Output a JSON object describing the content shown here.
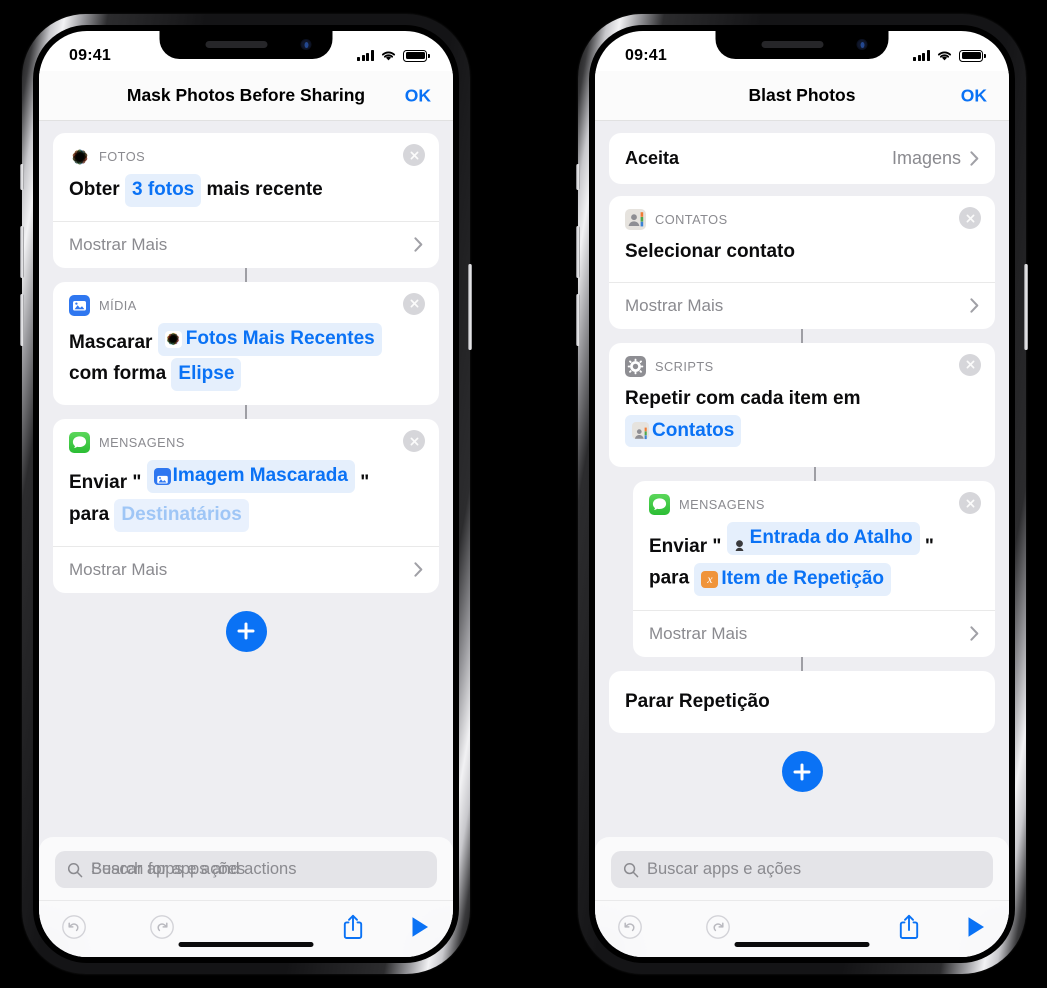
{
  "background_color": "#000000",
  "accent_color": "#0a72f5",
  "phones": [
    {
      "id": "left",
      "status": {
        "time": "09:41",
        "signal_icon": "cellular-bars-icon",
        "wifi_icon": "wifi-icon",
        "battery_icon": "battery-full-icon"
      },
      "nav": {
        "title": "Mask Photos Before Sharing",
        "action_label": "OK"
      },
      "cards": [
        {
          "type": "action",
          "app": "FOTOS",
          "app_icon": "photos-app-icon",
          "close_icon": "close-circle-icon",
          "line": {
            "pre": "Obter",
            "token": "3 fotos",
            "token_style": "blue",
            "post": "mais recente"
          },
          "show_more": "Mostrar Mais",
          "chevron_icon": "chevron-right-icon"
        },
        {
          "type": "action",
          "app": "MÍDIA",
          "app_icon": "media-app-icon",
          "close_icon": "close-circle-icon",
          "line1": {
            "pre": "Mascarar",
            "token": "Fotos Mais Recentes",
            "token_icon": "photos-app-icon",
            "token_style": "blue"
          },
          "line2": {
            "pre": "com forma",
            "token": "Elipse",
            "token_style": "blue"
          }
        },
        {
          "type": "action",
          "app": "MENSAGENS",
          "app_icon": "messages-app-icon",
          "close_icon": "close-circle-icon",
          "line1": {
            "pre": "Enviar \"",
            "token": "Imagem Mascarada",
            "token_icon": "media-app-icon",
            "token_style": "blue",
            "post": "\""
          },
          "line2": {
            "pre": "para",
            "token": "Destinatários",
            "token_style": "faded"
          },
          "show_more": "Mostrar Mais",
          "chevron_icon": "chevron-right-icon"
        }
      ],
      "add_button_icon": "plus-circle-icon",
      "search": {
        "icon": "search-icon",
        "placeholder": "Search for apps and actions",
        "placeholder_overlay": "Buscar apps e ações"
      },
      "toolbar": [
        {
          "name": "undo-icon",
          "enabled": false
        },
        {
          "name": "redo-icon",
          "enabled": false
        },
        {
          "name": "share-icon",
          "enabled": true
        },
        {
          "name": "play-icon",
          "enabled": true
        }
      ]
    },
    {
      "id": "right",
      "status": {
        "time": "09:41",
        "signal_icon": "cellular-bars-icon",
        "wifi_icon": "wifi-icon",
        "battery_icon": "battery-full-icon"
      },
      "nav": {
        "title": "Blast Photos",
        "action_label": "OK"
      },
      "accepts_row": {
        "label": "Aceita",
        "value": "Imagens",
        "chevron_icon": "chevron-right-icon"
      },
      "cards": [
        {
          "type": "action",
          "app": "CONTATOS",
          "app_icon": "contacts-app-icon",
          "close_icon": "close-circle-icon",
          "line": {
            "pre": "Selecionar contato"
          },
          "show_more": "Mostrar Mais",
          "chevron_icon": "chevron-right-icon"
        },
        {
          "type": "action",
          "app": "SCRIPTS",
          "app_icon": "scripts-app-icon",
          "close_icon": "close-circle-icon",
          "line1": {
            "pre": "Repetir com cada item em"
          },
          "line2": {
            "token": "Contatos",
            "token_icon": "contacts-app-icon",
            "token_style": "blue"
          }
        },
        {
          "type": "action",
          "indent": true,
          "app": "MENSAGENS",
          "app_icon": "messages-app-icon",
          "close_icon": "close-circle-icon",
          "line1": {
            "pre": "Enviar \"",
            "token": "Entrada do Atalho",
            "token_icon": "shortcut-input-icon",
            "token_style": "blue",
            "post": "\""
          },
          "line2": {
            "pre": "para",
            "token": "Item de Repetição",
            "token_icon": "variable-x-icon",
            "token_style": "blue"
          },
          "show_more": "Mostrar Mais",
          "chevron_icon": "chevron-right-icon"
        },
        {
          "type": "plain",
          "label": "Parar Repetição"
        }
      ],
      "add_button_icon": "plus-circle-icon",
      "search": {
        "icon": "search-icon",
        "placeholder": "Buscar apps e ações",
        "placeholder_overlay": ""
      },
      "toolbar": [
        {
          "name": "undo-icon",
          "enabled": false
        },
        {
          "name": "redo-icon",
          "enabled": false
        },
        {
          "name": "share-icon",
          "enabled": true
        },
        {
          "name": "play-icon",
          "enabled": true
        }
      ]
    }
  ]
}
